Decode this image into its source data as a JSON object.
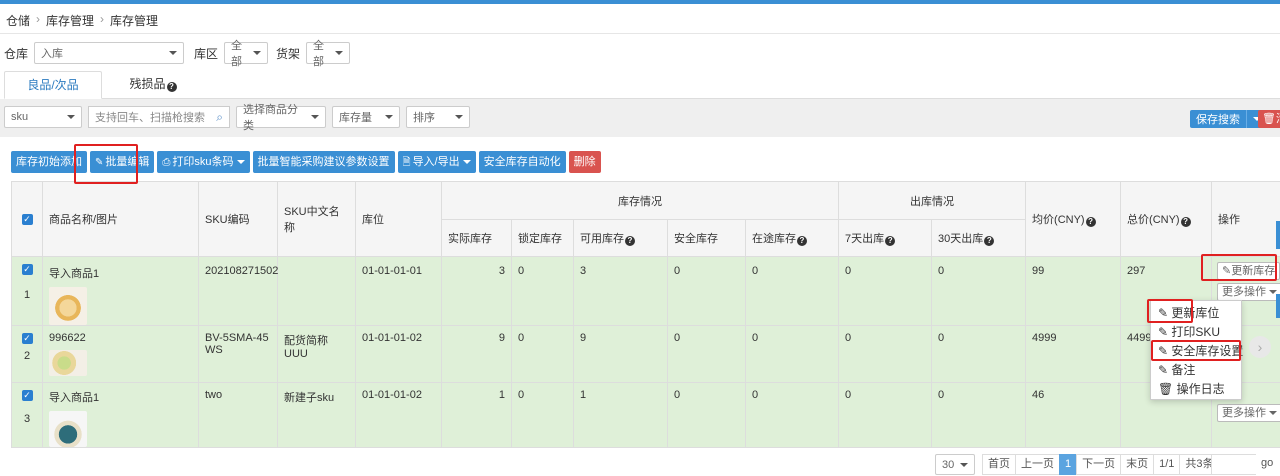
{
  "breadcrumb": [
    "仓储",
    "库存管理",
    "库存管理"
  ],
  "filters": {
    "warehouse_label": "仓库",
    "warehouse_value": "入库",
    "area_label": "库区",
    "area_value": "全部",
    "shelf_label": "货架",
    "shelf_value": "全部"
  },
  "tabs": [
    {
      "label": "良品/次品",
      "active": true
    },
    {
      "label": "残损品",
      "active": false
    }
  ],
  "search": {
    "sku_select": "sku",
    "search_placeholder": "支持回车、扫描枪搜索",
    "category_select": "选择商品分类",
    "stock_select": "库存量",
    "sort_select": "排序",
    "save_search": "保存搜索",
    "clear": "清"
  },
  "toolbar": {
    "init_add": "库存初始添加",
    "batch_edit": "批量编辑",
    "print_sku": "打印sku条码",
    "smart_purchase": "批量智能采购建议参数设置",
    "import_export": "导入/导出",
    "safety_auto": "安全库存自动化",
    "delete": "删除"
  },
  "table": {
    "headers": {
      "product": "商品名称/图片",
      "sku": "SKU编码",
      "sku_cn": "SKU中文名称",
      "location": "库位",
      "stock_group": "库存情况",
      "actual": "实际库存",
      "locked": "锁定库存",
      "available": "可用库存",
      "safety": "安全库存",
      "transit": "在途库存",
      "outbound_group": "出库情况",
      "out7": "7天出库",
      "out30": "30天出库",
      "avg_price": "均价(CNY)",
      "total_price": "总价(CNY)",
      "ops": "操作"
    },
    "rows": [
      {
        "index": "1",
        "name": "导入商品1",
        "sku": "202108271502",
        "sku_cn": "",
        "location": "01-01-01-01",
        "actual": "3",
        "locked": "0",
        "available": "3",
        "safety": "0",
        "transit": "0",
        "out7": "0",
        "out30": "0",
        "avg": "99",
        "total": "297"
      },
      {
        "index": "2",
        "name": "996622",
        "sku": "BV-5SMA-45WS",
        "sku_cn": "配货简称UUU",
        "location": "01-01-01-02",
        "actual": "9",
        "locked": "0",
        "available": "9",
        "safety": "0",
        "transit": "0",
        "out7": "0",
        "out30": "0",
        "avg": "4999",
        "total": "44991"
      },
      {
        "index": "3",
        "name": "导入商品1",
        "sku": "two",
        "sku_cn": "新建子sku",
        "location": "01-01-01-02",
        "actual": "1",
        "locked": "0",
        "available": "1",
        "safety": "0",
        "transit": "0",
        "out7": "0",
        "out30": "0",
        "avg": "46",
        "total": ""
      }
    ]
  },
  "ops": {
    "update_stock": "更新库存",
    "more": "更多操作"
  },
  "menu": {
    "update_location": "更新库位",
    "print_sku": "打印SKU",
    "safety_settings": "安全库存设置",
    "note": "备注",
    "log": "操作日志"
  },
  "pagination": {
    "page_size": "30",
    "first": "首页",
    "prev": "上一页",
    "current": "1",
    "next": "下一页",
    "last": "末页",
    "pages": "1/1",
    "total": "共3条",
    "go": "go"
  },
  "colors": {
    "accent": "#3a8fd4",
    "danger": "#d9534f",
    "row_selected": "#dff0d8",
    "highlight": "#e02020"
  }
}
